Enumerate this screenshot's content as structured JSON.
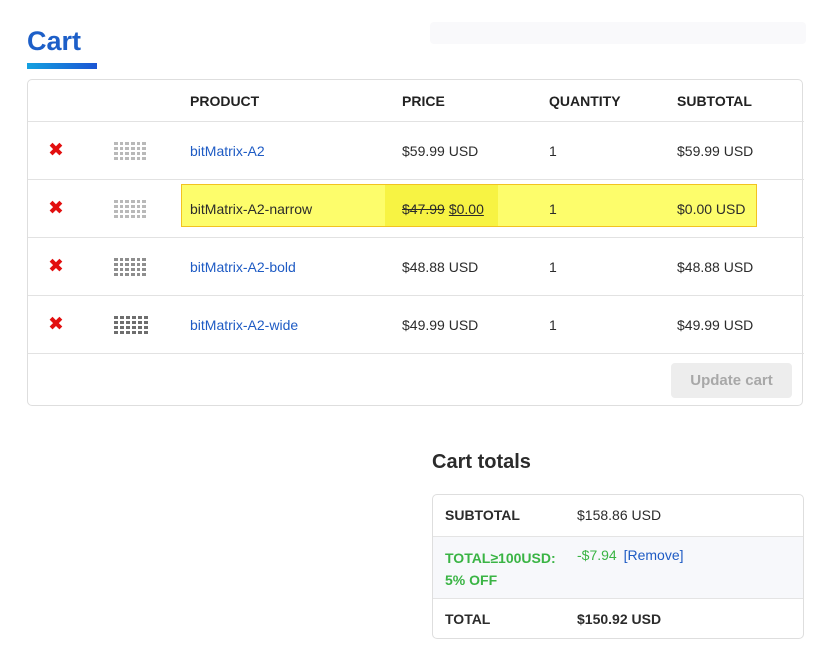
{
  "page": {
    "title": "Cart"
  },
  "cart": {
    "headers": {
      "product": "PRODUCT",
      "price": "PRICE",
      "quantity": "QUANTITY",
      "subtotal": "SUBTOTAL"
    },
    "items": [
      {
        "remove_icon": "✖",
        "name": "bitMatrix-A2",
        "price": "$59.99 USD",
        "quantity": "1",
        "subtotal": "$59.99 USD"
      },
      {
        "remove_icon": "✖",
        "name": "bitMatrix-A2-narrow",
        "price_old": "$47.99",
        "price_new": "$0.00",
        "quantity": "1",
        "subtotal": "$0.00 USD",
        "highlighted": true
      },
      {
        "remove_icon": "✖",
        "name": "bitMatrix-A2-bold",
        "price": "$48.88 USD",
        "quantity": "1",
        "subtotal": "$48.88 USD"
      },
      {
        "remove_icon": "✖",
        "name": "bitMatrix-A2-wide",
        "price": "$49.99 USD",
        "quantity": "1",
        "subtotal": "$49.99 USD"
      }
    ],
    "update_label": "Update cart"
  },
  "totals": {
    "title": "Cart totals",
    "subtotal_label": "SUBTOTAL",
    "subtotal_value": "$158.86 USD",
    "discount_label_1": "TOTAL≥100USD:",
    "discount_label_2": "5% OFF",
    "discount_value": "-$7.94",
    "remove_label": "[Remove]",
    "total_label": "TOTAL",
    "total_value": "$150.92 USD"
  },
  "colors": {
    "accent": "#1d5fc8",
    "remove": "#e20f0f",
    "discount": "#3ab444",
    "highlight": "#fdfd6b"
  },
  "icons": {
    "remove": "close-icon",
    "thumbnail": "font-preview-icon"
  }
}
